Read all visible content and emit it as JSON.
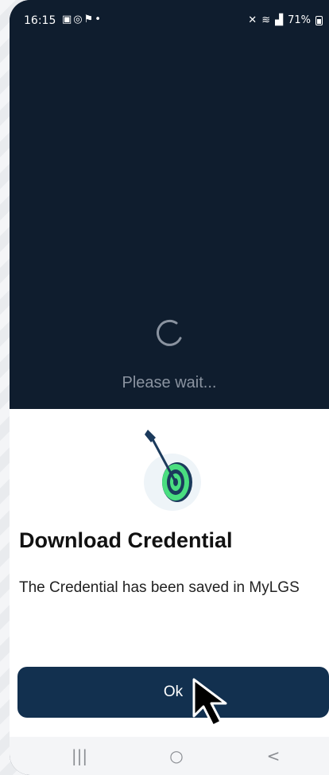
{
  "status_bar": {
    "time": "16:15",
    "notification_icons": [
      "gallery-icon",
      "sync-icon",
      "teams-icon",
      "dot-icon"
    ],
    "right_icons": [
      "mute-icon",
      "wifi-icon",
      "signal-icon"
    ],
    "battery": "71%"
  },
  "loading": {
    "message": "Please wait..."
  },
  "dialog": {
    "title": "Download Credential",
    "message": "The Credential has been saved in MyLGS",
    "ok_label": "Ok"
  },
  "nav_bar": {
    "recents_glyph": "|||",
    "home_glyph": "○",
    "back_glyph": "<"
  },
  "colors": {
    "background_dark": "#0f1d2e",
    "button": "#12304f",
    "target_green": "#4ade80",
    "target_navy": "#1b3a5c"
  }
}
